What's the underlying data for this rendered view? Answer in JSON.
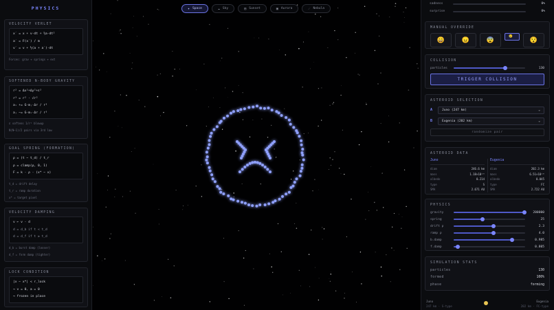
{
  "brand": "PHYSICS",
  "left_cards": [
    {
      "title": "VELOCITY VERLET",
      "lines": [
        "x′ = x + v·dt + ½a·dt²",
        "a′ = F(x′) / m",
        "v′ = v + ½(a + a′)·dt"
      ],
      "notes": [
        "Forces: grav + springs + ext"
      ]
    },
    {
      "title": "SOFTENED N-BODY GRAVITY",
      "lines": [
        "r² = Δx²+Δy²+ε²",
        "r³ = r² · √r²",
        "aᵢ += G·mⱼ·Δr / r³",
        "aⱼ −= G·mᵢ·Δr / r³"
      ],
      "notes": [
        "ε softens 1/r² blowup",
        "N(N−1)/2 pairs via 3rd law"
      ]
    },
    {
      "title": "GOAL SPRING (FORMATION)",
      "lines": [
        "ρ = (t − t_d) / t_r",
        "ρ = clamp(ρ, 0, 1)",
        "F = k · ρ · (x* − x)"
      ],
      "notes": [
        "t_d = drift delay",
        "t_r = ramp duration",
        "x* = target pixel"
      ]
    },
    {
      "title": "VELOCITY DAMPING",
      "lines": [
        "v ← v · d",
        "  d = d_b if t < t_d",
        "  d = d_f if t ≥ t_d"
      ],
      "notes": [
        "d_b = burst damp (looser)",
        "d_f = form damp (tighter)"
      ]
    },
    {
      "title": "LOCK CONDITION",
      "lines": [
        "|x − x*| < r_lock",
        "→ v = 0, a = 0",
        "→ frozen in place"
      ],
      "notes": []
    }
  ],
  "modes": [
    {
      "icon": "✦",
      "label": "Space",
      "active": true
    },
    {
      "icon": "☁",
      "label": "Sky",
      "active": false
    },
    {
      "icon": "▤",
      "label": "Sunset",
      "active": false
    },
    {
      "icon": "▣",
      "label": "Aurora",
      "active": false
    },
    {
      "icon": "☄",
      "label": "Nebula",
      "active": false
    }
  ],
  "emotions": [
    {
      "label": "sadness",
      "value": "0%",
      "level": 0
    },
    {
      "label": "surprise",
      "value": "0%",
      "level": 0
    }
  ],
  "manual_override": {
    "title": "MANUAL OVERRIDE",
    "faces": [
      "😄",
      "😠",
      "😨",
      "😢",
      "😯"
    ],
    "selected": 3
  },
  "collision": {
    "title": "COLLISION",
    "label": "particles",
    "value": "130",
    "level": 0.72,
    "button": "TRIGGER COLLISION"
  },
  "asteroid_selection": {
    "title": "ASTEROID SELECTION",
    "a_label": "A",
    "a_value": "Juno (247 km)",
    "b_label": "B",
    "b_value": "Eugenia (202 km)",
    "randomize": "randomize pair"
  },
  "asteroid_data": {
    "title": "ASTEROID DATA",
    "a": {
      "name": "Juno",
      "rows": [
        [
          "diam",
          "246.6 km"
        ],
        [
          "mass",
          "1.18×10¹⁹"
        ],
        [
          "albedo",
          "0.214"
        ],
        [
          "type",
          "S"
        ],
        [
          "SMA",
          "2.671 AU"
        ]
      ]
    },
    "b": {
      "name": "Eugenia",
      "rows": [
        [
          "diam",
          "202.3 km"
        ],
        [
          "mass",
          "6.51×10¹⁸"
        ],
        [
          "albedo",
          "0.045"
        ],
        [
          "type",
          "FC"
        ],
        [
          "SMA",
          "2.722 AU"
        ]
      ]
    }
  },
  "physics": {
    "title": "PHYSICS",
    "rows": [
      {
        "label": "gravity",
        "value": "200000",
        "level": 0.99
      },
      {
        "label": "spring",
        "value": "25",
        "level": 0.4
      },
      {
        "label": "drift ρ",
        "value": "2.3",
        "level": 0.56
      },
      {
        "label": "ramp ρ",
        "value": "4.0",
        "level": 0.56
      },
      {
        "label": "b.damp",
        "value": "0.985",
        "level": 0.82
      },
      {
        "label": "f.damp",
        "value": "0.805",
        "level": 0.06
      }
    ]
  },
  "sim_stats": {
    "title": "SIMULATION STATS",
    "rows": [
      [
        "particles",
        "130"
      ],
      [
        "formed",
        "100%"
      ],
      [
        "phase",
        "forming"
      ]
    ]
  },
  "footer": {
    "left_name": "Juno",
    "left_sub": "247 km · S-type",
    "right_name": "Eugenia",
    "right_sub": "202 km · FC-type"
  }
}
